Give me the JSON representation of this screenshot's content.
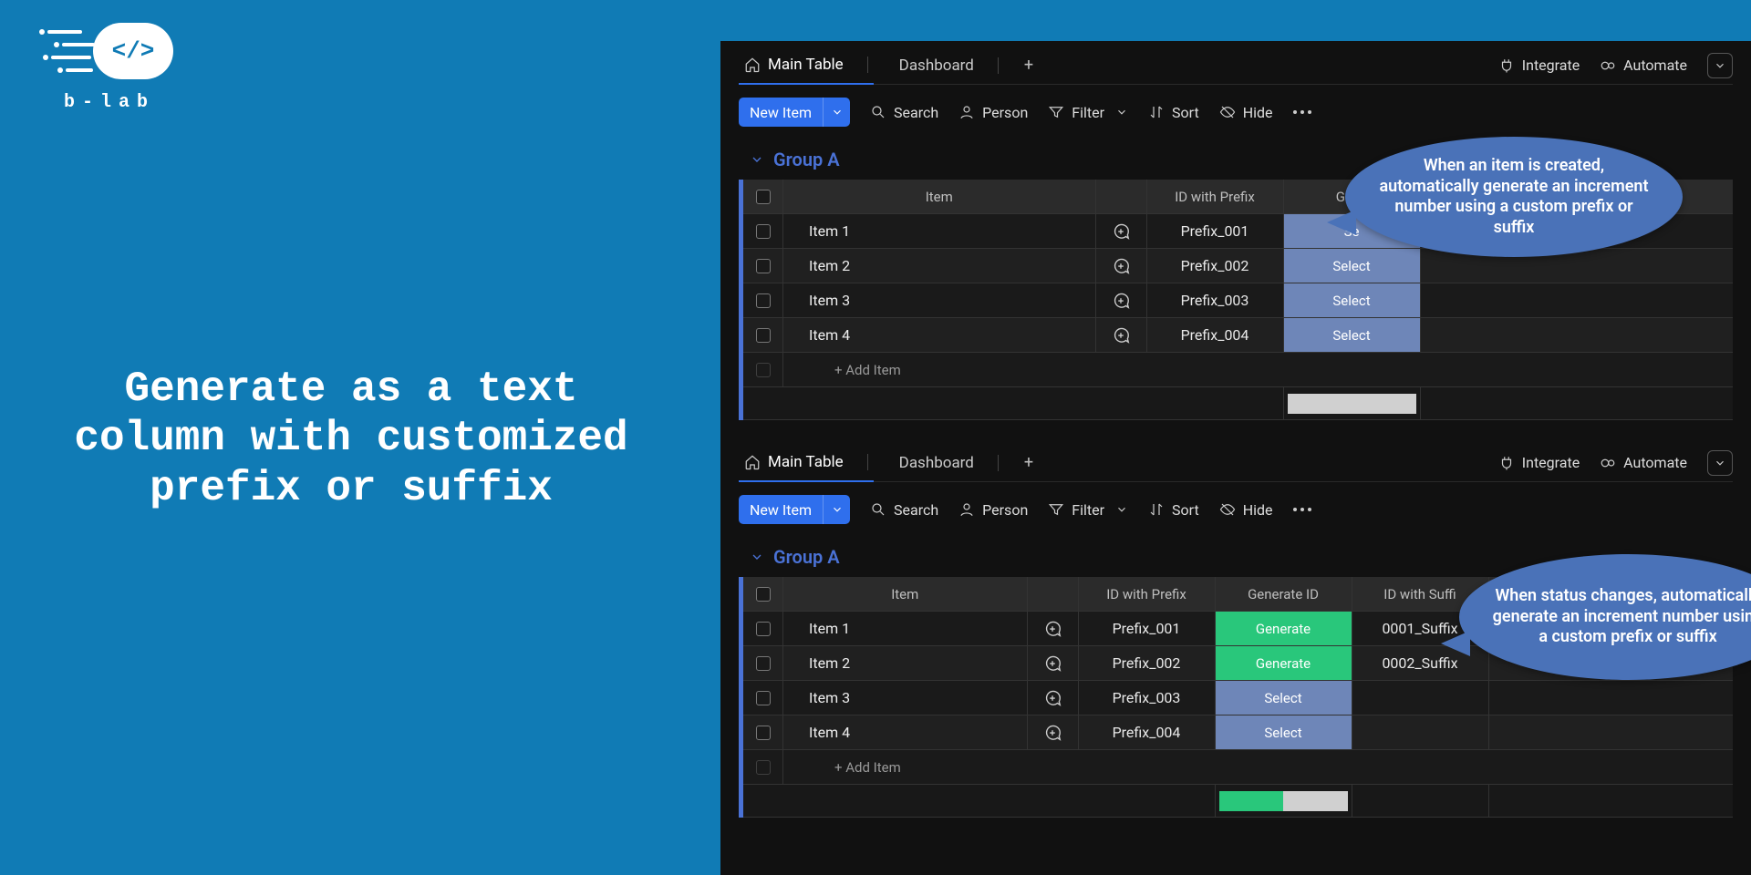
{
  "brand": {
    "name": "b-lab",
    "mark": "</>"
  },
  "headline": "Generate as a text column with customized prefix or suffix",
  "tabs": {
    "main": "Main Table",
    "dashboard": "Dashboard"
  },
  "topright": {
    "integrate": "Integrate",
    "automate": "Automate"
  },
  "toolbar": {
    "new_item": "New Item",
    "search": "Search",
    "person": "Person",
    "filter": "Filter",
    "sort": "Sort",
    "hide": "Hide"
  },
  "board1": {
    "group": "Group A",
    "columns": {
      "item": "Item",
      "id_prefix": "ID with Prefix",
      "gen": "Gene"
    },
    "rows": [
      {
        "item": "Item 1",
        "prefix": "Prefix_001",
        "gen_label": "Se",
        "gen_kind": "select"
      },
      {
        "item": "Item 2",
        "prefix": "Prefix_002",
        "gen_label": "Select",
        "gen_kind": "select"
      },
      {
        "item": "Item 3",
        "prefix": "Prefix_003",
        "gen_label": "Select",
        "gen_kind": "select"
      },
      {
        "item": "Item 4",
        "prefix": "Prefix_004",
        "gen_label": "Select",
        "gen_kind": "select"
      }
    ],
    "add": "+ Add Item",
    "summary_fill_pct": 0
  },
  "board2": {
    "group": "Group A",
    "columns": {
      "item": "Item",
      "id_prefix": "ID with Prefix",
      "gen": "Generate ID",
      "id_suffix": "ID with Suffi"
    },
    "rows": [
      {
        "item": "Item 1",
        "prefix": "Prefix_001",
        "gen_label": "Generate",
        "gen_kind": "gen",
        "suffix": "0001_Suffix"
      },
      {
        "item": "Item 2",
        "prefix": "Prefix_002",
        "gen_label": "Generate",
        "gen_kind": "gen",
        "suffix": "0002_Suffix"
      },
      {
        "item": "Item 3",
        "prefix": "Prefix_003",
        "gen_label": "Select",
        "gen_kind": "select",
        "suffix": ""
      },
      {
        "item": "Item 4",
        "prefix": "Prefix_004",
        "gen_label": "Select",
        "gen_kind": "select",
        "suffix": ""
      }
    ],
    "add": "+ Add Item",
    "summary_fill_pct": 50
  },
  "callouts": {
    "c1": "When an item is created, automatically generate an increment number using a custom prefix or suffix",
    "c2": "When status changes, automatically generate an increment number using a custom prefix or suffix"
  }
}
